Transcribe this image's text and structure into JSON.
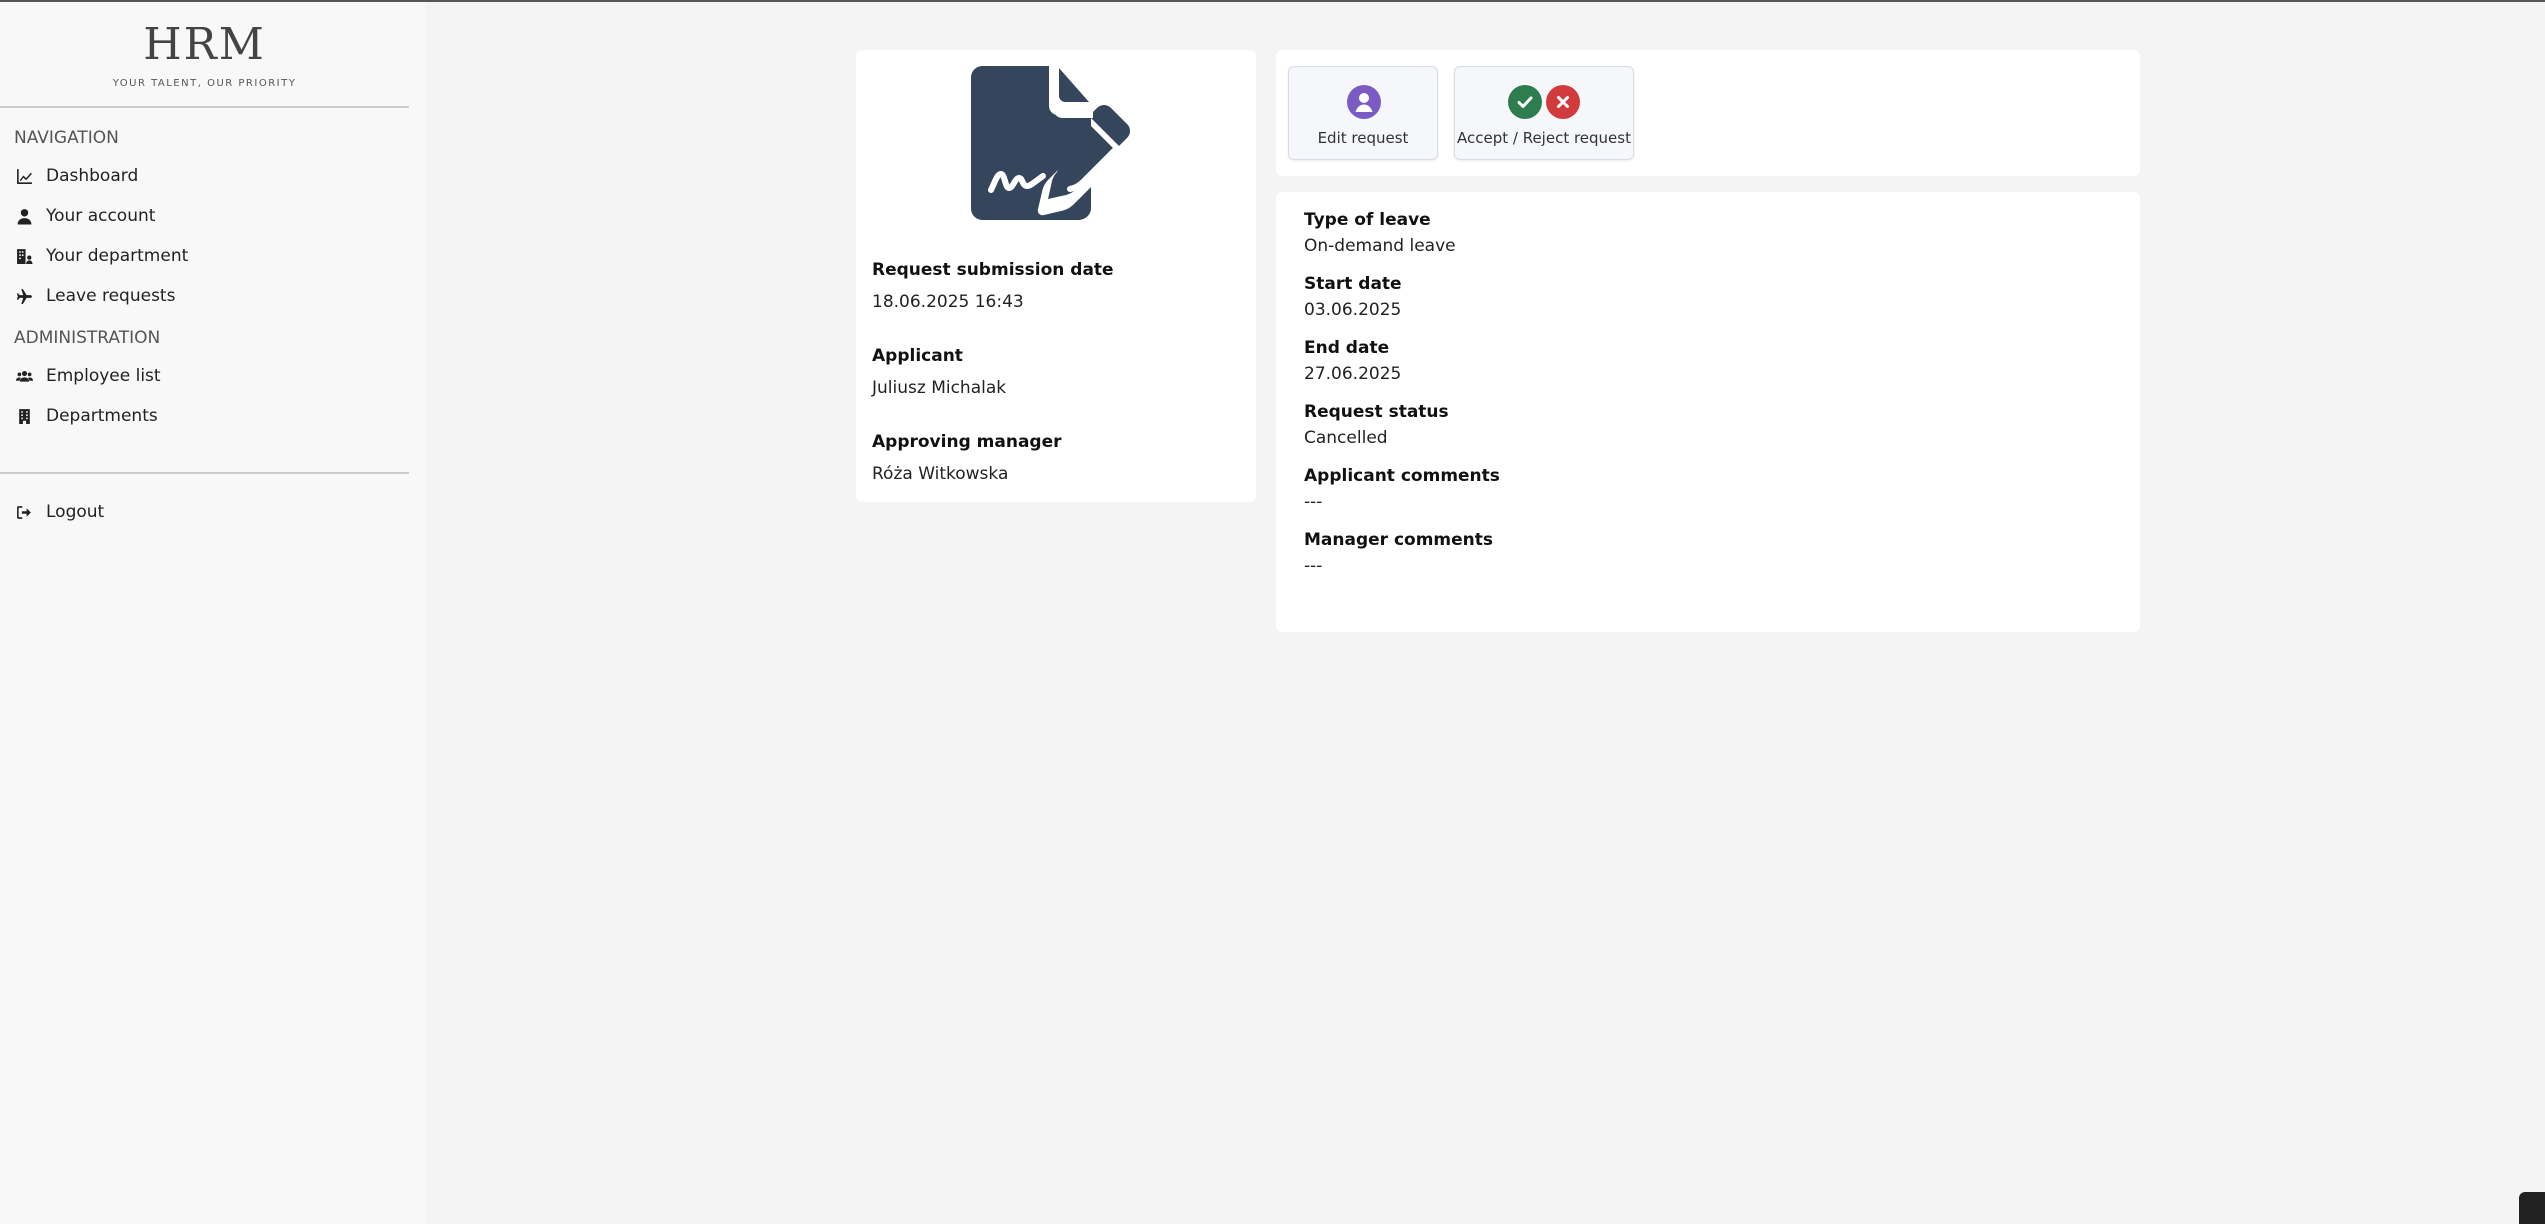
{
  "brand": {
    "title": "HRM",
    "subtitle": "YOUR TALENT, OUR PRIORITY"
  },
  "sidebar": {
    "navigation_title": "NAVIGATION",
    "nav_items": [
      {
        "label": "Dashboard",
        "icon": "chart-line-icon"
      },
      {
        "label": "Your account",
        "icon": "user-icon"
      },
      {
        "label": "Your department",
        "icon": "building-user-icon"
      },
      {
        "label": "Leave requests",
        "icon": "plane-icon"
      }
    ],
    "administration_title": "ADMINISTRATION",
    "admin_items": [
      {
        "label": "Employee list",
        "icon": "users-icon"
      },
      {
        "label": "Departments",
        "icon": "building-icon"
      }
    ],
    "logout": {
      "label": "Logout",
      "icon": "logout-icon"
    }
  },
  "request_summary": {
    "icon": "file-signature-icon",
    "submission_date_label": "Request submission date",
    "submission_date": "18.06.2025 16:43",
    "applicant_label": "Applicant",
    "applicant": "Juliusz Michalak",
    "manager_label": "Approving manager",
    "manager": "Róża Witkowska"
  },
  "actions": {
    "edit": {
      "label": "Edit request",
      "icon": "user-circle-icon",
      "color": "#7b5cc4"
    },
    "accept_reject": {
      "label": "Accept / Reject request",
      "accept_icon": "check-icon",
      "reject_icon": "x-icon",
      "accept_color": "#2e7d4f",
      "reject_color": "#d13b3b"
    }
  },
  "details": {
    "type_label": "Type of leave",
    "type": "On-demand leave",
    "start_label": "Start date",
    "start": "03.06.2025",
    "end_label": "End date",
    "end": "27.06.2025",
    "status_label": "Request status",
    "status": "Cancelled",
    "applicant_comments_label": "Applicant comments",
    "applicant_comments": "---",
    "manager_comments_label": "Manager comments",
    "manager_comments": "---"
  },
  "colors": {
    "doc_icon": "#34455c",
    "background": "#f4f4f4"
  }
}
